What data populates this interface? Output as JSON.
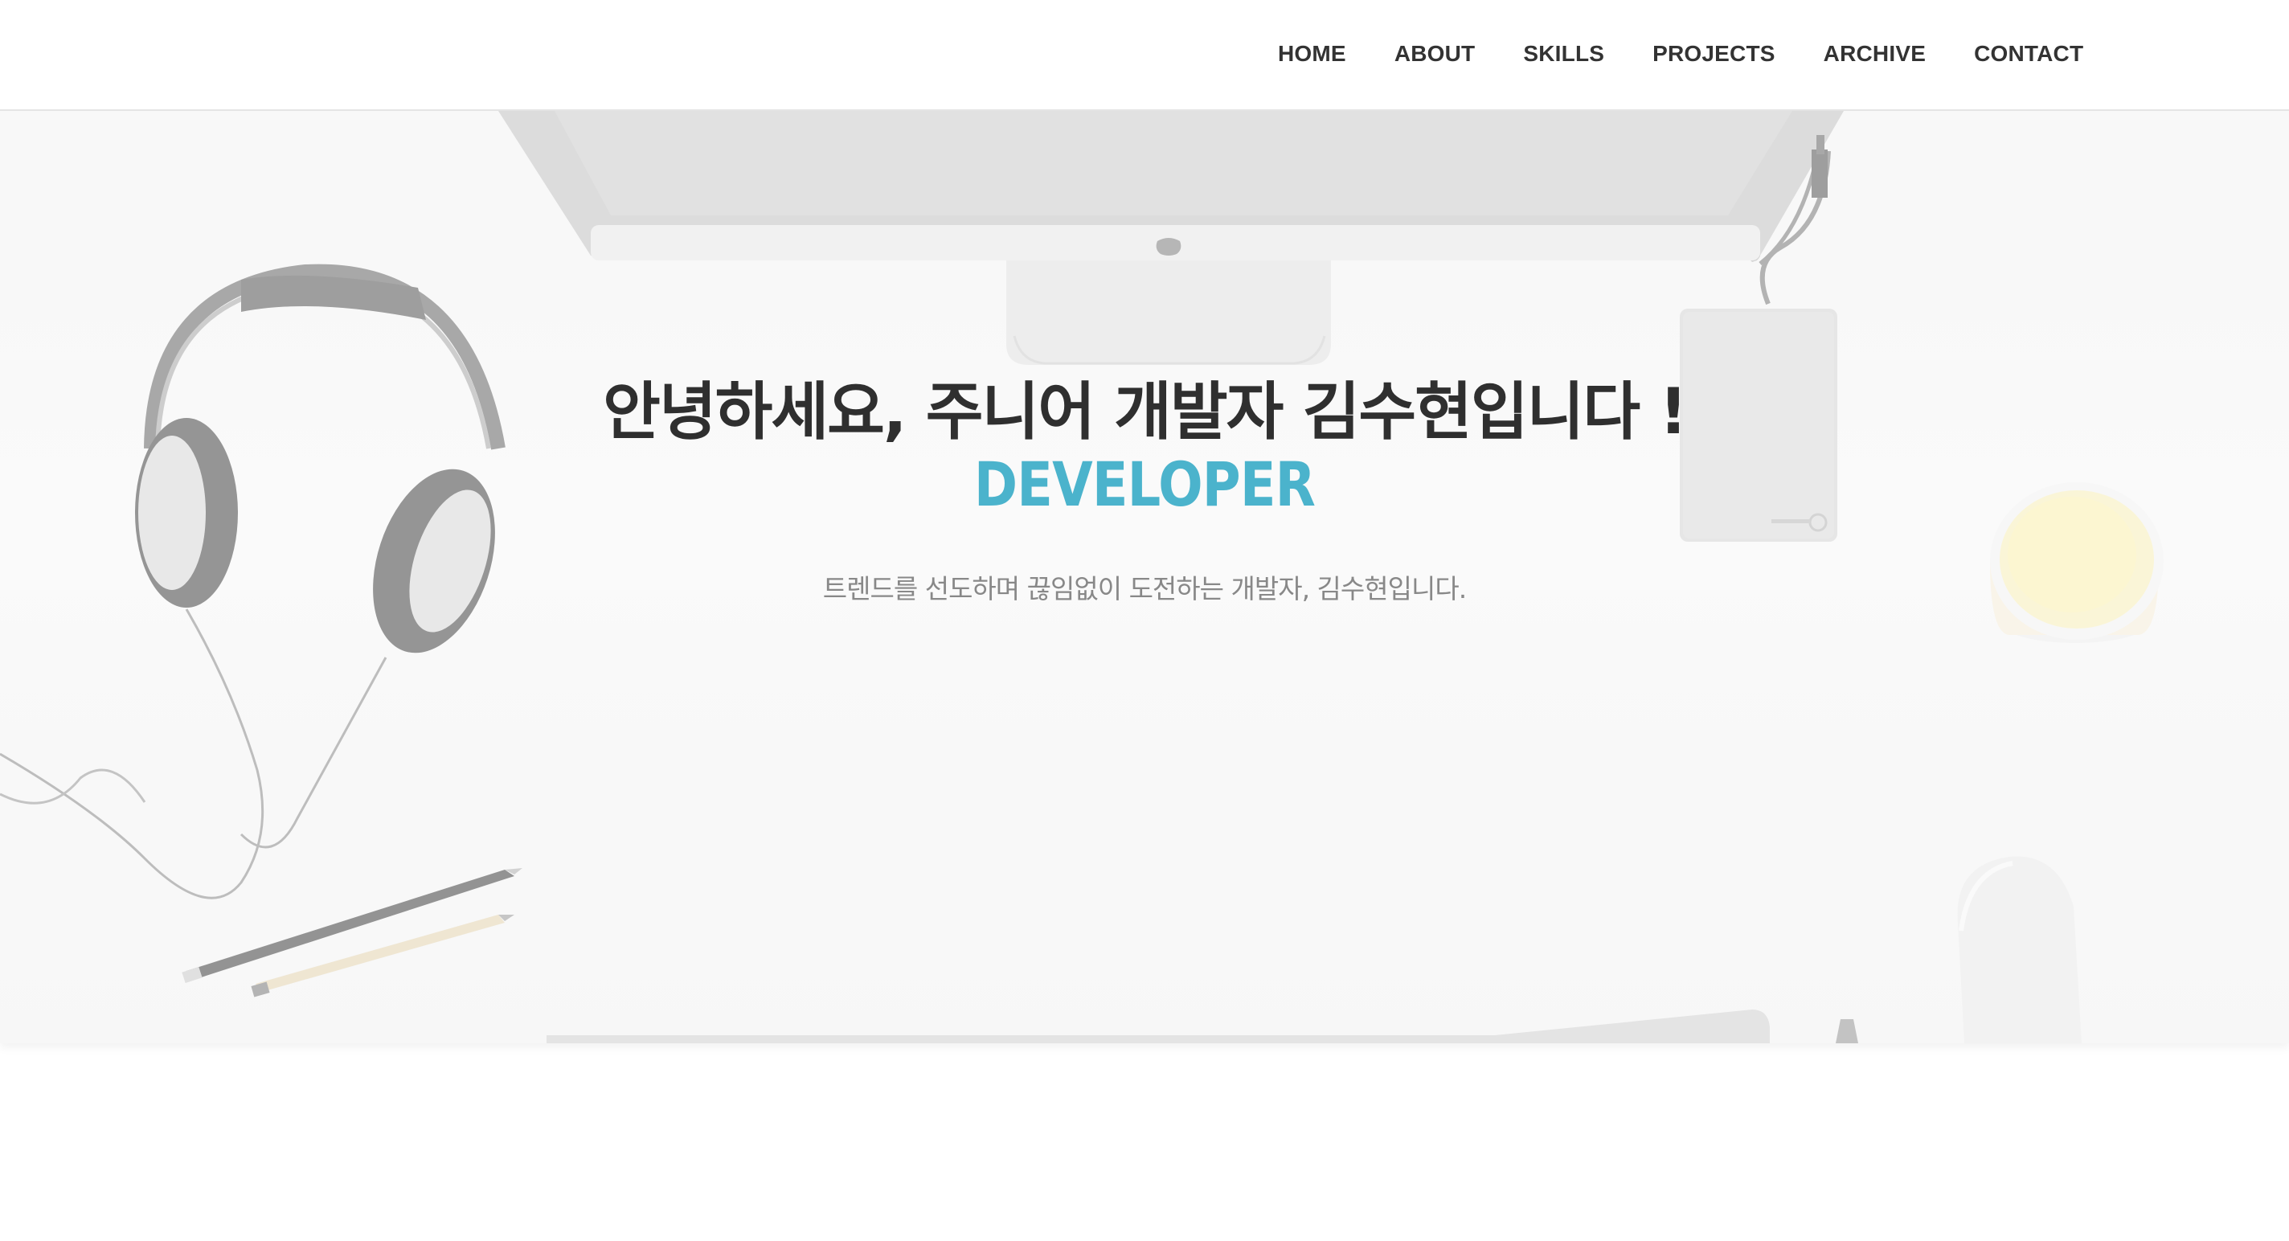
{
  "nav": {
    "items": [
      {
        "label": "HOME"
      },
      {
        "label": "ABOUT"
      },
      {
        "label": "SKILLS"
      },
      {
        "label": "PROJECTS"
      },
      {
        "label": "ARCHIVE"
      },
      {
        "label": "CONTACT"
      }
    ]
  },
  "hero": {
    "title": "안녕하세요, 주니어 개발자 김수현입니다 !",
    "subtitle": "DEVELOPER",
    "description": "트렌드를 선도하며 끊임없이 도전하는 개발자, 김수현입니다."
  },
  "colors": {
    "accent": "#4bb3cc",
    "title_text": "#2f2f2f",
    "nav_text": "#333333",
    "desc_text": "#888888"
  }
}
